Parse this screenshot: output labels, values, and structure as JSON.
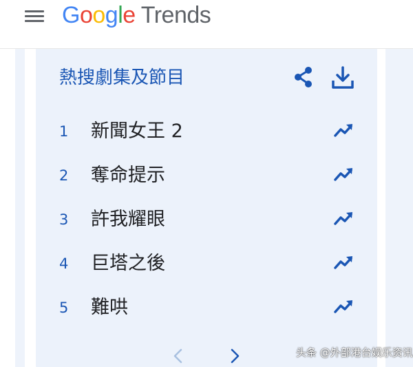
{
  "header": {
    "logo_letters": [
      "G",
      "o",
      "o",
      "g",
      "l",
      "e"
    ],
    "product": "Trends"
  },
  "card": {
    "title": "熱搜劇集及節目",
    "items": [
      {
        "rank": "1",
        "name": "新聞女王 2"
      },
      {
        "rank": "2",
        "name": "奪命提示"
      },
      {
        "rank": "3",
        "name": "許我耀眼"
      },
      {
        "rank": "4",
        "name": "巨塔之後"
      },
      {
        "rank": "5",
        "name": "難哄"
      }
    ]
  },
  "icons": {
    "menu": "menu-icon",
    "share": "share-icon",
    "download": "download-icon",
    "trend": "trending-up-icon",
    "prev": "chevron-left-icon",
    "next": "chevron-right-icon"
  },
  "colors": {
    "accent": "#1a56b4",
    "card_bg": "#ecf2fb",
    "text": "#202124",
    "pager_disabled": "#a8c0e0"
  },
  "watermark": "头条 @外部港台娱乐资讯"
}
